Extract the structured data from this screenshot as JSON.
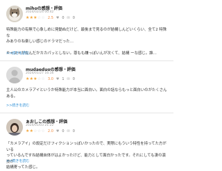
{
  "reviews": [
    {
      "name": "mihoの感想・評価",
      "date": "2024/02/24 00:42",
      "stars": "★★★",
      "stars_off": "☆☆",
      "score": "2.5",
      "likes": "0",
      "comments": "0",
      "avatar": "cat-avatar",
      "lines": [
        "特殊能力の有無で心象しめに発動ぬだけど、最後まで見るのが結構しんどいくらい、全て2 特殊な",
        "みありのね楽しい感じのドラマだった…",
        "",
        "キャストがなんだかカカパッとしない。尊もも嫌っぽいんが次くて、結構 ーな感じ。誰…"
      ],
      "more": ">>続きを読む"
    },
    {
      "name": "mudaeduoの感想・評価",
      "date": "2024/01/27 16:16",
      "stars": "★★★",
      "stars_off": "☆☆",
      "score": "3.0",
      "likes": "1",
      "comments": "0",
      "avatar": "default-avatar",
      "lines": [
        "主人公のカメラアイというか特殊能力が本当に面白い。面白の話ならもっと面白いのがたくさんある。"
      ],
      "more": ">>続きを読む"
    },
    {
      "name": "ぁおしこの感想・評価",
      "date": "2024/01/03 21:22",
      "stars": "★★",
      "stars_off": "☆☆☆",
      "score": "2.0",
      "likes": "0",
      "comments": "0",
      "avatar": "photo-avatar",
      "lines": [
        "「カメラアイ」の設定だけフィクションっぽいかったので、実際にもういう特性を持ってた方がいる",
        "っているんですね結構自体がはよかったけど、能力として面白かったです。それにしても凄の演技が",
        "結構寄ってた感じ。"
      ],
      "more": ">>続きを読む"
    }
  ]
}
